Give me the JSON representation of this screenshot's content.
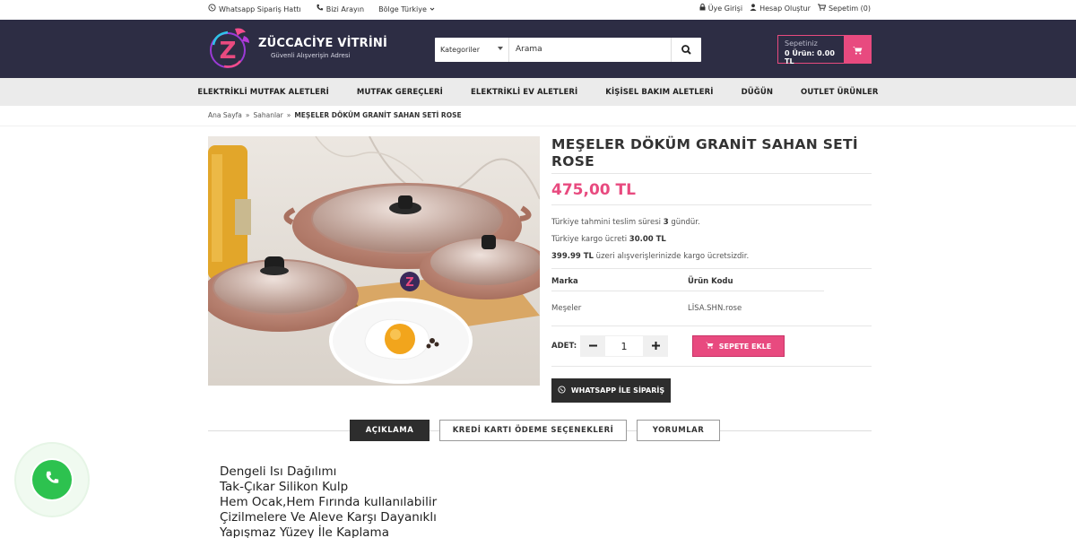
{
  "topbar": {
    "whatsapp": "Whatsapp Sipariş Hattı",
    "call": "Bizi Arayın",
    "region": "Bölge Türkiye",
    "login": "Üye Girişi",
    "register": "Hesap Oluştur",
    "cart": "Sepetim (0)"
  },
  "logo": {
    "name": "ZÜCCACİYE VİTRİNİ",
    "slogan": "Güvenli Alışverişin Adresi",
    "letter": "Z"
  },
  "search": {
    "category": "Kategoriler",
    "placeholder": "Arama"
  },
  "cart": {
    "title": "Sepetiniz",
    "summary": "0 Ürün: 0.00 TL"
  },
  "nav": [
    "ELEKTRİKLİ MUTFAK ALETLERİ",
    "MUTFAK GEREÇLERİ",
    "ELEKTRİKLİ EV ALETLERİ",
    "KİŞİSEL BAKIM ALETLERİ",
    "DÜĞÜN",
    "OUTLET ÜRÜNLER"
  ],
  "breadcrumb": {
    "home": "Ana Sayfa",
    "category": "Sahanlar",
    "current": "MEŞELER DÖKÜM GRANİT SAHAN SETİ ROSE",
    "sep": "»"
  },
  "product": {
    "title": "MEŞELER DÖKÜM GRANİT SAHAN SETİ ROSE",
    "price": "475,00 TL",
    "delivery_pre": "Türkiye tahmini teslim süresi ",
    "delivery_days": "3",
    "delivery_post": " gündür.",
    "shipping_pre": "Türkiye kargo ücreti ",
    "shipping_fee": "30.00 TL",
    "free_limit": "399.99 TL",
    "free_post": " üzeri alışverişlerinizde kargo ücretsizdir.",
    "brand_label": "Marka",
    "brand": "Meşeler",
    "code_label": "Ürün Kodu",
    "code": "LİSA.SHN.rose",
    "qty_label": "ADET:",
    "qty": "1",
    "add_to_cart": "SEPETE EKLE",
    "whatsapp_order": "WHATSAPP İLE SİPARİŞ"
  },
  "tabs": [
    "AÇIKLAMA",
    "KREDİ KARTI ÖDEME SEÇENEKLERİ",
    "YORUMLAR"
  ],
  "description": [
    "Dengeli Isı Dağılımı",
    "Tak-Çıkar Silikon Kulp",
    "Hem Ocak,Hem Fırında kullanılabilir",
    "Çizilmelere Ve Aleve Karşı Dayanıklı",
    "Yapışmaz Yüzey İle Kaplama"
  ],
  "colors": {
    "accent": "#e84a7f",
    "header": "#2d2d44",
    "dark": "#2d2d2d",
    "whatsapp": "#2dc24f"
  }
}
